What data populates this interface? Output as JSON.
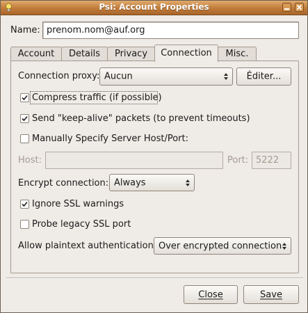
{
  "window": {
    "title": "Psi: Account Properties"
  },
  "name_field": {
    "label": "Name:",
    "value": "prenom.nom@auf.org"
  },
  "tabs": [
    {
      "label": "Account",
      "active": false
    },
    {
      "label": "Details",
      "active": false
    },
    {
      "label": "Privacy",
      "active": false
    },
    {
      "label": "Connection",
      "active": true
    },
    {
      "label": "Misc.",
      "active": false
    }
  ],
  "connection": {
    "proxy_label": "Connection proxy:",
    "proxy_value": "Aucun",
    "edit_button": "Éditer...",
    "compress": {
      "label": "Compress traffic (if possible)",
      "checked": true
    },
    "keepalive": {
      "label": "Send \"keep-alive\" packets (to prevent timeouts)",
      "checked": true
    },
    "manual_host": {
      "label": "Manually Specify Server Host/Port:",
      "checked": false
    },
    "host_label": "Host:",
    "host_value": "",
    "port_label": "Port:",
    "port_value": "5222",
    "encrypt_label": "Encrypt connection:",
    "encrypt_value": "Always",
    "ignore_ssl": {
      "label": "Ignore SSL warnings",
      "checked": true
    },
    "probe_ssl": {
      "label": "Probe legacy SSL port",
      "checked": false
    },
    "plaintext_label": "Allow plaintext authentication:",
    "plaintext_value": "Over encrypted connection"
  },
  "footer": {
    "close_label": "Close",
    "save_label": "Save"
  },
  "colors": {
    "titlebar": "#c07b3a",
    "window_bg": "#efebe7"
  }
}
